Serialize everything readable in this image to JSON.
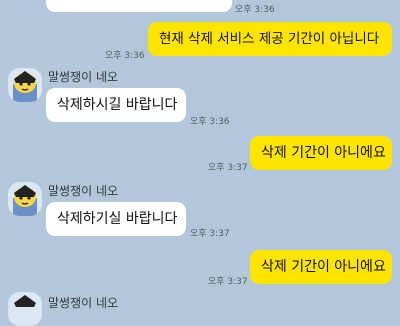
{
  "chat": {
    "messages": [
      {
        "id": "m0",
        "from": "me",
        "text": "",
        "time": "오후 3:36"
      },
      {
        "id": "m1",
        "from": "me",
        "text": "현재 삭제 서비스 제공 기간이 아닙니다",
        "time": "오후 3:36"
      },
      {
        "id": "m2",
        "from": "them",
        "sender": "말썽쟁이 네오",
        "text": "삭제하시길 바랍니다",
        "time": "오후 3:36"
      },
      {
        "id": "m3",
        "from": "me",
        "text": "삭제 기간이 아니에요",
        "time": "오후 3:37"
      },
      {
        "id": "m4",
        "from": "them",
        "sender": "말썽쟁이 네오",
        "text": "삭제하기실 바랍니다",
        "time": "오후 3:37"
      },
      {
        "id": "m5",
        "from": "me",
        "text": "삭제 기간이 아니에요",
        "time": "오후 3:37"
      },
      {
        "id": "m6",
        "from": "them",
        "sender": "말썽쟁이 네오",
        "text": "",
        "time": ""
      }
    ]
  },
  "colors": {
    "background": "#b2c7d9",
    "my_bubble": "#fee500",
    "their_bubble": "#ffffff",
    "time_text": "#555c66"
  },
  "icons": {
    "avatar": "neo-character-avatar-icon"
  }
}
